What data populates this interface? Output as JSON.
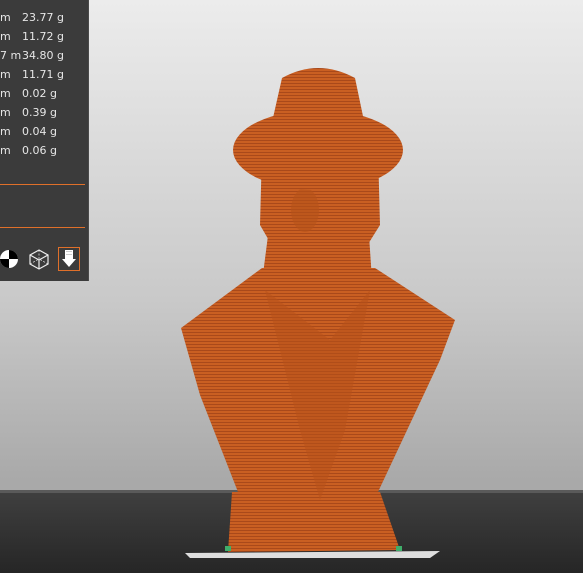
{
  "filament_panel": {
    "rows": [
      {
        "unit": "m",
        "weight": "23.77 g"
      },
      {
        "unit": "m",
        "weight": "11.72 g"
      },
      {
        "unit": "7 m",
        "weight": "34.80 g"
      },
      {
        "unit": "m",
        "weight": "11.71 g"
      },
      {
        "unit": "m",
        "weight": "0.02 g"
      },
      {
        "unit": "m",
        "weight": "0.39 g"
      },
      {
        "unit": "m",
        "weight": "0.04 g"
      },
      {
        "unit": "m",
        "weight": "0.06 g"
      }
    ]
  },
  "view_toolbar": {
    "items": [
      {
        "icon": "section-view-icon"
      },
      {
        "icon": "wireframe-cube-icon"
      },
      {
        "icon": "layer-download-icon",
        "active": true
      }
    ]
  },
  "colors": {
    "accent": "#e0702a",
    "model": "#c85e21",
    "panel": "#3b3b3b"
  }
}
